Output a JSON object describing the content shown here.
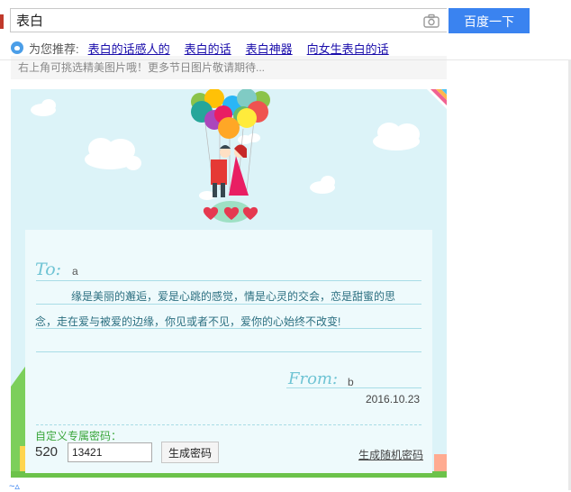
{
  "search": {
    "query": "表白",
    "button_label": "百度一下",
    "camera_icon": "camera-icon"
  },
  "recommend": {
    "label": "为您推荐:",
    "links": [
      "表白的话感人的",
      "表白的话",
      "表白神器",
      "向女生表白的话"
    ]
  },
  "notice": {
    "text": "右上角可挑选精美图片哦！更多节日图片敬请期待..."
  },
  "card": {
    "to_label": "To:",
    "to_value": "a",
    "body_line1": "缘是美丽的邂逅，爱是心跳的感觉，情是心灵的交会，恋是甜蜜的思",
    "body_line2": "念，走在爱与被爱的边缘，你见或者不见，爱你的心始终不改变!",
    "from_label": "From:",
    "from_value": "b",
    "date": "2016.10.23"
  },
  "password": {
    "label": "自定义专属密码：",
    "prefix": "520",
    "value": "13421",
    "generate_label": "生成密码",
    "random_label": "生成随机密码"
  },
  "colors": {
    "search_button": "#3a83f0",
    "link": "#1a0dab",
    "card_bg": "#dcf3f8",
    "accent_green": "#3aa63a"
  }
}
